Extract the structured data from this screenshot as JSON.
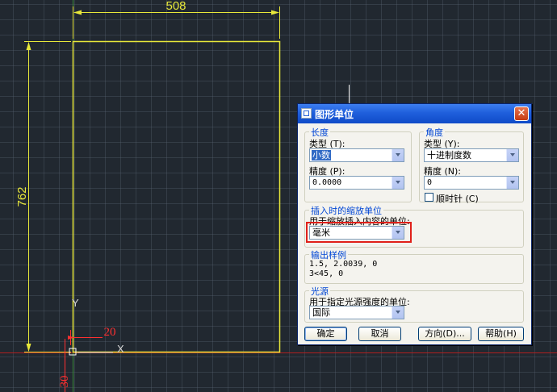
{
  "drawing": {
    "dim_width": "508",
    "dim_height": "762",
    "dim_small_x": "20",
    "dim_small_y": "30",
    "ucs_y_label": "Y",
    "ucs_x_label": "X",
    "colors": {
      "background": "#212830",
      "outline": "#e8e83a",
      "dimension_red": "#ff3030"
    }
  },
  "dialog": {
    "title": "图形单位",
    "close_glyph": "✕",
    "length": {
      "legend": "长度",
      "type_label": "类型 (T):",
      "type_value": "小数",
      "precision_label": "精度 (P):",
      "precision_value": "0.0000"
    },
    "angle": {
      "legend": "角度",
      "type_label": "类型 (Y):",
      "type_value": "十进制度数",
      "precision_label": "精度 (N):",
      "precision_value": "0",
      "clockwise_label": "顺时针 (C)",
      "clockwise_checked": false
    },
    "insert": {
      "legend": "插入时的缩放单位",
      "desc": "用于缩放插入内容的单位:",
      "value": "毫米"
    },
    "sample": {
      "legend": "输出样例",
      "line1": "1.5, 2.0039, 0",
      "line2": "3<45, 0"
    },
    "light": {
      "legend": "光源",
      "desc": "用于指定光源强度的单位:",
      "value": "国际"
    },
    "buttons": {
      "ok": "确定",
      "cancel": "取消",
      "direction": "方向(D)...",
      "help": "帮助(H)"
    }
  }
}
